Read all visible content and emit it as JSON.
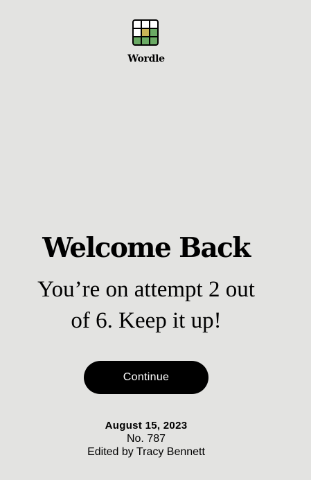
{
  "app": {
    "name": "Wordle",
    "logo_icon": "wordle-grid-icon",
    "logo_cells": [
      "empty",
      "empty",
      "empty",
      "empty",
      "present",
      "correct",
      "correct",
      "correct",
      "correct"
    ],
    "colors": {
      "background": "#e3e3e1",
      "present": "#c9b458",
      "correct": "#6aaa64",
      "button": "#000000"
    }
  },
  "welcome": {
    "title": "Welcome Back",
    "subtitle_line1": "You’re on attempt 2 out",
    "subtitle_line2": "of 6. Keep it up!"
  },
  "continue_button": {
    "label": "Continue"
  },
  "puzzle_info": {
    "date": "August 15, 2023",
    "number": "No. 787",
    "editor": "Edited by Tracy Bennett"
  }
}
